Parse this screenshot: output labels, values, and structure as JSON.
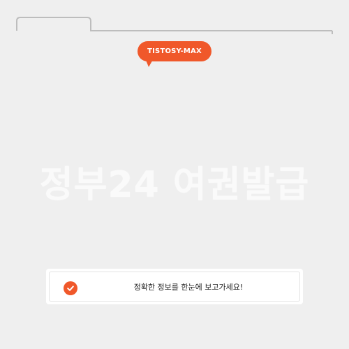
{
  "badge": {
    "label": "TISTOSY-MAX"
  },
  "hero": {
    "title": "정부24 여권발급"
  },
  "notice": {
    "text": "정확한 정보를 한눈에 보고가세요!",
    "icon": "check-circle-icon"
  },
  "colors": {
    "accent": "#f0582a",
    "background": "#efefef",
    "frame_line": "#bdbdbd"
  }
}
